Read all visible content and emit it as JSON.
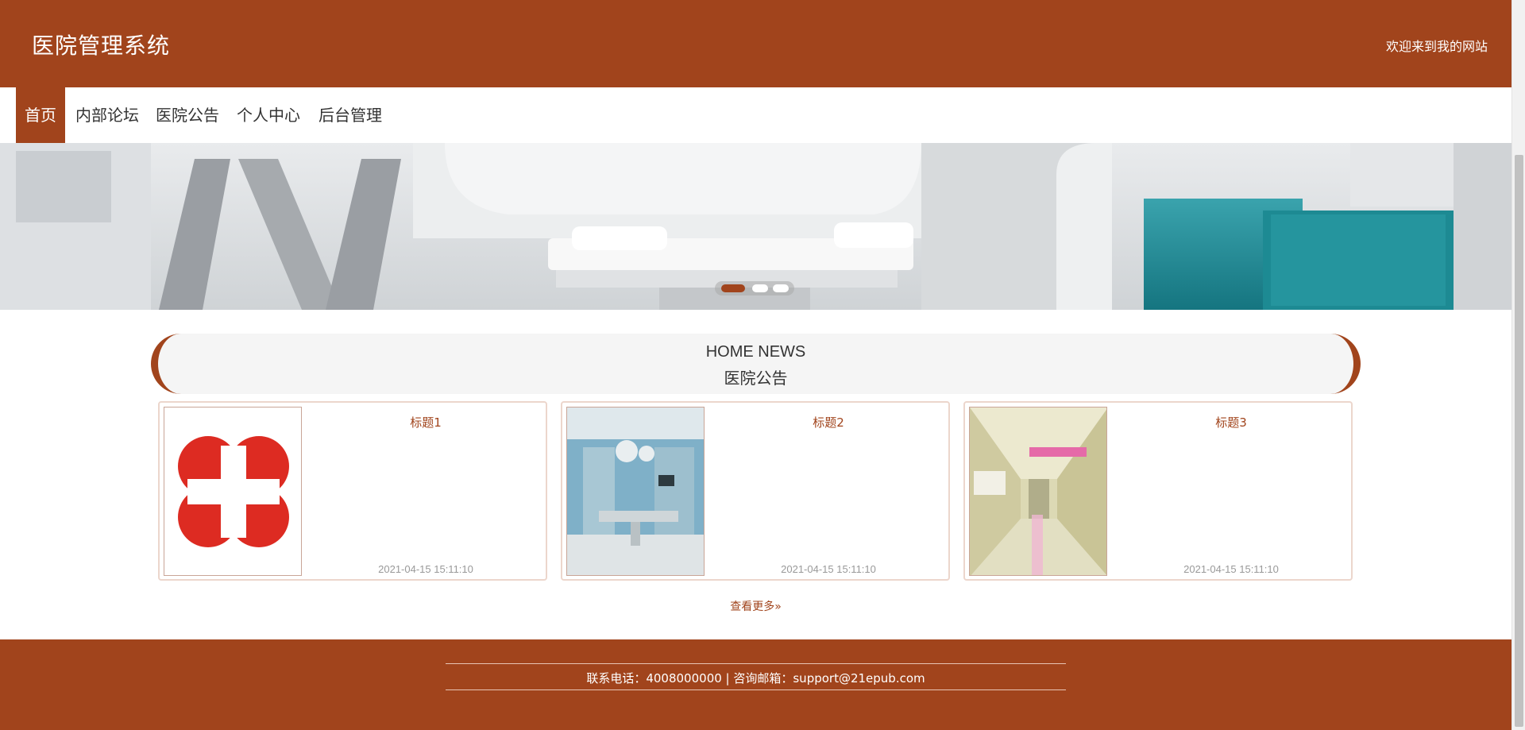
{
  "header": {
    "site_title": "医院管理系统",
    "welcome_text": "欢迎来到我的网站"
  },
  "nav": {
    "items": [
      {
        "label": "首页",
        "active": true
      },
      {
        "label": "内部论坛",
        "active": false
      },
      {
        "label": "医院公告",
        "active": false
      },
      {
        "label": "个人中心",
        "active": false
      },
      {
        "label": "后台管理",
        "active": false
      }
    ]
  },
  "banner": {
    "slide_count": 3,
    "active_slide": 1
  },
  "news": {
    "heading_en": "HOME NEWS",
    "heading_cn": "医院公告",
    "cards": [
      {
        "title": "标题1",
        "date": "2021-04-15 15:11:10",
        "thumb": "red-cross-logo"
      },
      {
        "title": "标题2",
        "date": "2021-04-15 15:11:10",
        "thumb": "operating-room-photo"
      },
      {
        "title": "标题3",
        "date": "2021-04-15 15:11:10",
        "thumb": "hospital-corridor-photo"
      }
    ],
    "more_label": "查看更多",
    "more_icon": "double-chevron-right-icon"
  },
  "footer": {
    "contact_text": "联系电话：4008000000 | 咨询邮箱：support@21epub.com"
  },
  "colors": {
    "brand": "#a1441c",
    "card_border": "#ecd6cc",
    "heading_bg": "#f5f5f5"
  }
}
